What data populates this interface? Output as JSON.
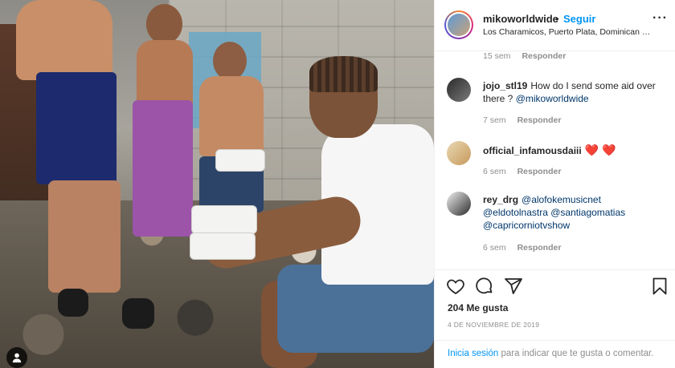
{
  "post": {
    "username": "mikoworldwide",
    "separator": "•",
    "follow_label": "Seguir",
    "location": "Los Charamicos, Puerto Plata, Dominican Rep...",
    "more_icon": "more-options-icon"
  },
  "comments": {
    "first_meta": {
      "time": "15 sem",
      "reply": "Responder"
    },
    "items": [
      {
        "username": "jojo_stl19",
        "text": "How do I send some aid over there ? ",
        "mention": "@mikoworldwide",
        "time": "7 sem",
        "reply": "Responder"
      },
      {
        "username": "official_infamousdaiii",
        "text": "",
        "hearts": "❤️ ❤️",
        "time": "6 sem",
        "reply": "Responder"
      },
      {
        "username": "rey_drg",
        "mentions": [
          "@alofokemusicnet",
          "@eldotolnastra",
          "@santiagomatias",
          "@capricorniotvshow"
        ],
        "time": "6 sem",
        "reply": "Responder"
      }
    ]
  },
  "actions": {
    "like_icon": "heart-icon",
    "comment_icon": "comment-icon",
    "share_icon": "share-icon",
    "save_icon": "bookmark-icon"
  },
  "likes": "204 Me gusta",
  "date": "4 DE NOVIEMBRE DE 2019",
  "login": {
    "link": "Inicia sesión",
    "rest": "para indicar que te gusta o comentar."
  },
  "colors": {
    "accent": "#0095f6",
    "heart": "#ed1c24",
    "muted": "#8e8e8e"
  }
}
